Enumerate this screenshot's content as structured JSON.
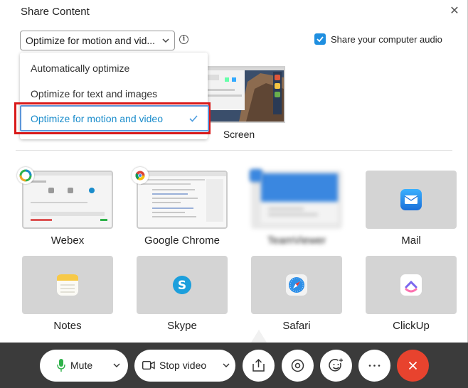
{
  "dialog": {
    "title": "Share Content",
    "optimize_selected": "Optimize for motion and vid...",
    "share_audio_label": "Share your computer audio",
    "share_audio_checked": true
  },
  "dropdown": {
    "options": [
      "Automatically optimize",
      "Optimize for text and images",
      "Optimize for motion and video"
    ],
    "selected_index": 2
  },
  "screen": {
    "label": "Screen"
  },
  "apps": [
    {
      "name": "Webex"
    },
    {
      "name": "Google Chrome"
    },
    {
      "name": "TeamViewer"
    },
    {
      "name": "Mail"
    },
    {
      "name": "Notes"
    },
    {
      "name": "Skype"
    },
    {
      "name": "Safari"
    },
    {
      "name": "ClickUp"
    }
  ],
  "controls": {
    "mute_label": "Mute",
    "stop_video_label": "Stop video"
  },
  "colors": {
    "accent": "#1a8ccb",
    "highlight_box": "#d91a1a",
    "end_call": "#e8432e",
    "mic_green": "#2fb24a"
  }
}
